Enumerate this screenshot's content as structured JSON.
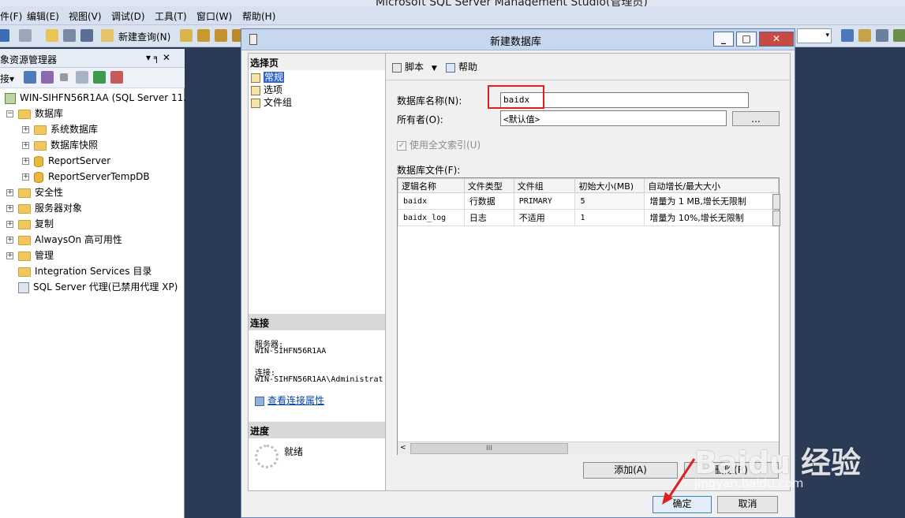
{
  "app": {
    "title": "Microsoft SQL Server Management Studio(管理员)",
    "menu": [
      "件(F)",
      "编辑(E)",
      "视图(V)",
      "调试(D)",
      "工具(T)",
      "窗口(W)",
      "帮助(H)"
    ],
    "toolbar": {
      "new_query": "新建查询(N)"
    }
  },
  "object_explorer": {
    "title": "象资源管理器",
    "connect_label": "接▾",
    "pin_glyph": "▾ ╕ ✕",
    "server": "WIN-SIHFN56R1AA (SQL Server 11.",
    "databases": "数据库",
    "system_db": "系统数据库",
    "snapshots": "数据库快照",
    "report_server": "ReportServer",
    "report_temp": "ReportServerTempDB",
    "security": "安全性",
    "server_objects": "服务器对象",
    "replication": "复制",
    "alwayson": "AlwaysOn 高可用性",
    "management": "管理",
    "integration": "Integration Services 目录",
    "agent": "SQL Server 代理(已禁用代理 XP)"
  },
  "dialog": {
    "title": "新建数据库",
    "select_page": "选择页",
    "pages": {
      "general": "常规",
      "options": "选项",
      "filegroups": "文件组"
    },
    "connection": {
      "header": "连接",
      "server_label": "服务器:",
      "server_value": "WIN-SIHFN56R1AA",
      "conn_label": "连接:",
      "conn_value": "WIN-SIHFN56R1AA\\Administrat",
      "view_props": "查看连接属性"
    },
    "progress": {
      "header": "进度",
      "status": "就绪"
    },
    "toolbar": {
      "script": "脚本",
      "help": "帮助"
    },
    "db_name_label": "数据库名称(N):",
    "db_name_value": "baidx",
    "owner_label": "所有者(O):",
    "owner_value": "<默认值>",
    "owner_btn": "...",
    "fulltext": "使用全文索引(U)",
    "files_label": "数据库文件(F):",
    "columns": {
      "logical": "逻辑名称",
      "type": "文件类型",
      "filegroup": "文件组",
      "initial": "初始大小(MB)",
      "autogrowth": "自动增长/最大大小"
    },
    "rows": [
      {
        "logical": "baidx",
        "type": "行数据",
        "filegroup": "PRIMARY",
        "initial": "5",
        "autogrowth": "增量为 1 MB,增长无限制"
      },
      {
        "logical": "baidx_log",
        "type": "日志",
        "filegroup": "不适用",
        "initial": "1",
        "autogrowth": "增量为 10%,增长无限制"
      }
    ],
    "add_btn": "添加(A)",
    "remove_btn": "删除(R)",
    "ok_btn": "确定",
    "cancel_btn": "取消"
  },
  "watermark": {
    "main": "Baidu 经验",
    "sub": "jingyan.baidu.com"
  },
  "colors": {
    "highlight": "#e02020",
    "title_bg": "#c6d7ee"
  }
}
